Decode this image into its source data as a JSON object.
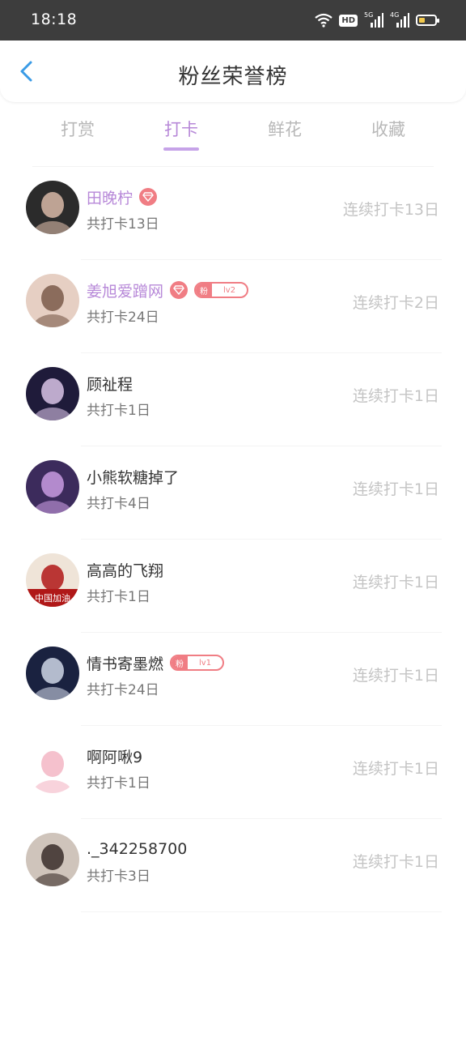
{
  "status": {
    "time": "18:18",
    "hd": "HD",
    "net1": "5G",
    "net2": "4G",
    "battery_level": 0.4
  },
  "header": {
    "title": "粉丝荣誉榜",
    "back_icon": "chevron-left-icon"
  },
  "tabs": [
    {
      "label": "打赏",
      "active": false
    },
    {
      "label": "打卡",
      "active": true
    },
    {
      "label": "鲜花",
      "active": false
    },
    {
      "label": "收藏",
      "active": false
    }
  ],
  "fans": [
    {
      "name": "田晚柠",
      "vip": true,
      "diamond": true,
      "badge": null,
      "total": "共打卡13日",
      "streak": "连续打卡13日",
      "avatar_colors": [
        "#2b2b2b",
        "#d8b9a7"
      ]
    },
    {
      "name": "姜旭爱蹭网",
      "vip": true,
      "diamond": true,
      "badge": {
        "fan": "粉",
        "level": "lv2"
      },
      "total": "共打卡24日",
      "streak": "连续打卡2日",
      "avatar_colors": [
        "#e6cfc3",
        "#7a5a4a"
      ]
    },
    {
      "name": "顾祉程",
      "vip": false,
      "diamond": false,
      "badge": null,
      "total": "共打卡1日",
      "streak": "连续打卡1日",
      "avatar_colors": [
        "#1f1b3a",
        "#d9c3e6"
      ]
    },
    {
      "name": "小熊软糖掉了",
      "vip": false,
      "diamond": false,
      "badge": null,
      "total": "共打卡4日",
      "streak": "连续打卡1日",
      "avatar_colors": [
        "#3c2b5c",
        "#c89be0"
      ]
    },
    {
      "name": "高高的飞翔",
      "vip": false,
      "diamond": false,
      "badge": null,
      "total": "共打卡1日",
      "streak": "连续打卡1日",
      "avatar_colors": [
        "#efe4d8",
        "#b01818"
      ],
      "avatar_text": "中国加油"
    },
    {
      "name": "情书寄墨燃",
      "vip": false,
      "diamond": false,
      "badge": {
        "fan": "粉",
        "level": "lv1"
      },
      "total": "共打卡24日",
      "streak": "连续打卡1日",
      "avatar_colors": [
        "#1a2240",
        "#cfd6e6"
      ]
    },
    {
      "name": "啊阿啾9",
      "vip": false,
      "diamond": false,
      "badge": null,
      "total": "共打卡1日",
      "streak": "连续打卡1日",
      "avatar_colors": [
        "#ffffff",
        "#f3b6c4"
      ]
    },
    {
      "name": "._342258700",
      "vip": false,
      "diamond": false,
      "badge": null,
      "total": "共打卡3日",
      "streak": "连续打卡1日",
      "avatar_colors": [
        "#cfc4bb",
        "#3a2e2a"
      ]
    }
  ]
}
